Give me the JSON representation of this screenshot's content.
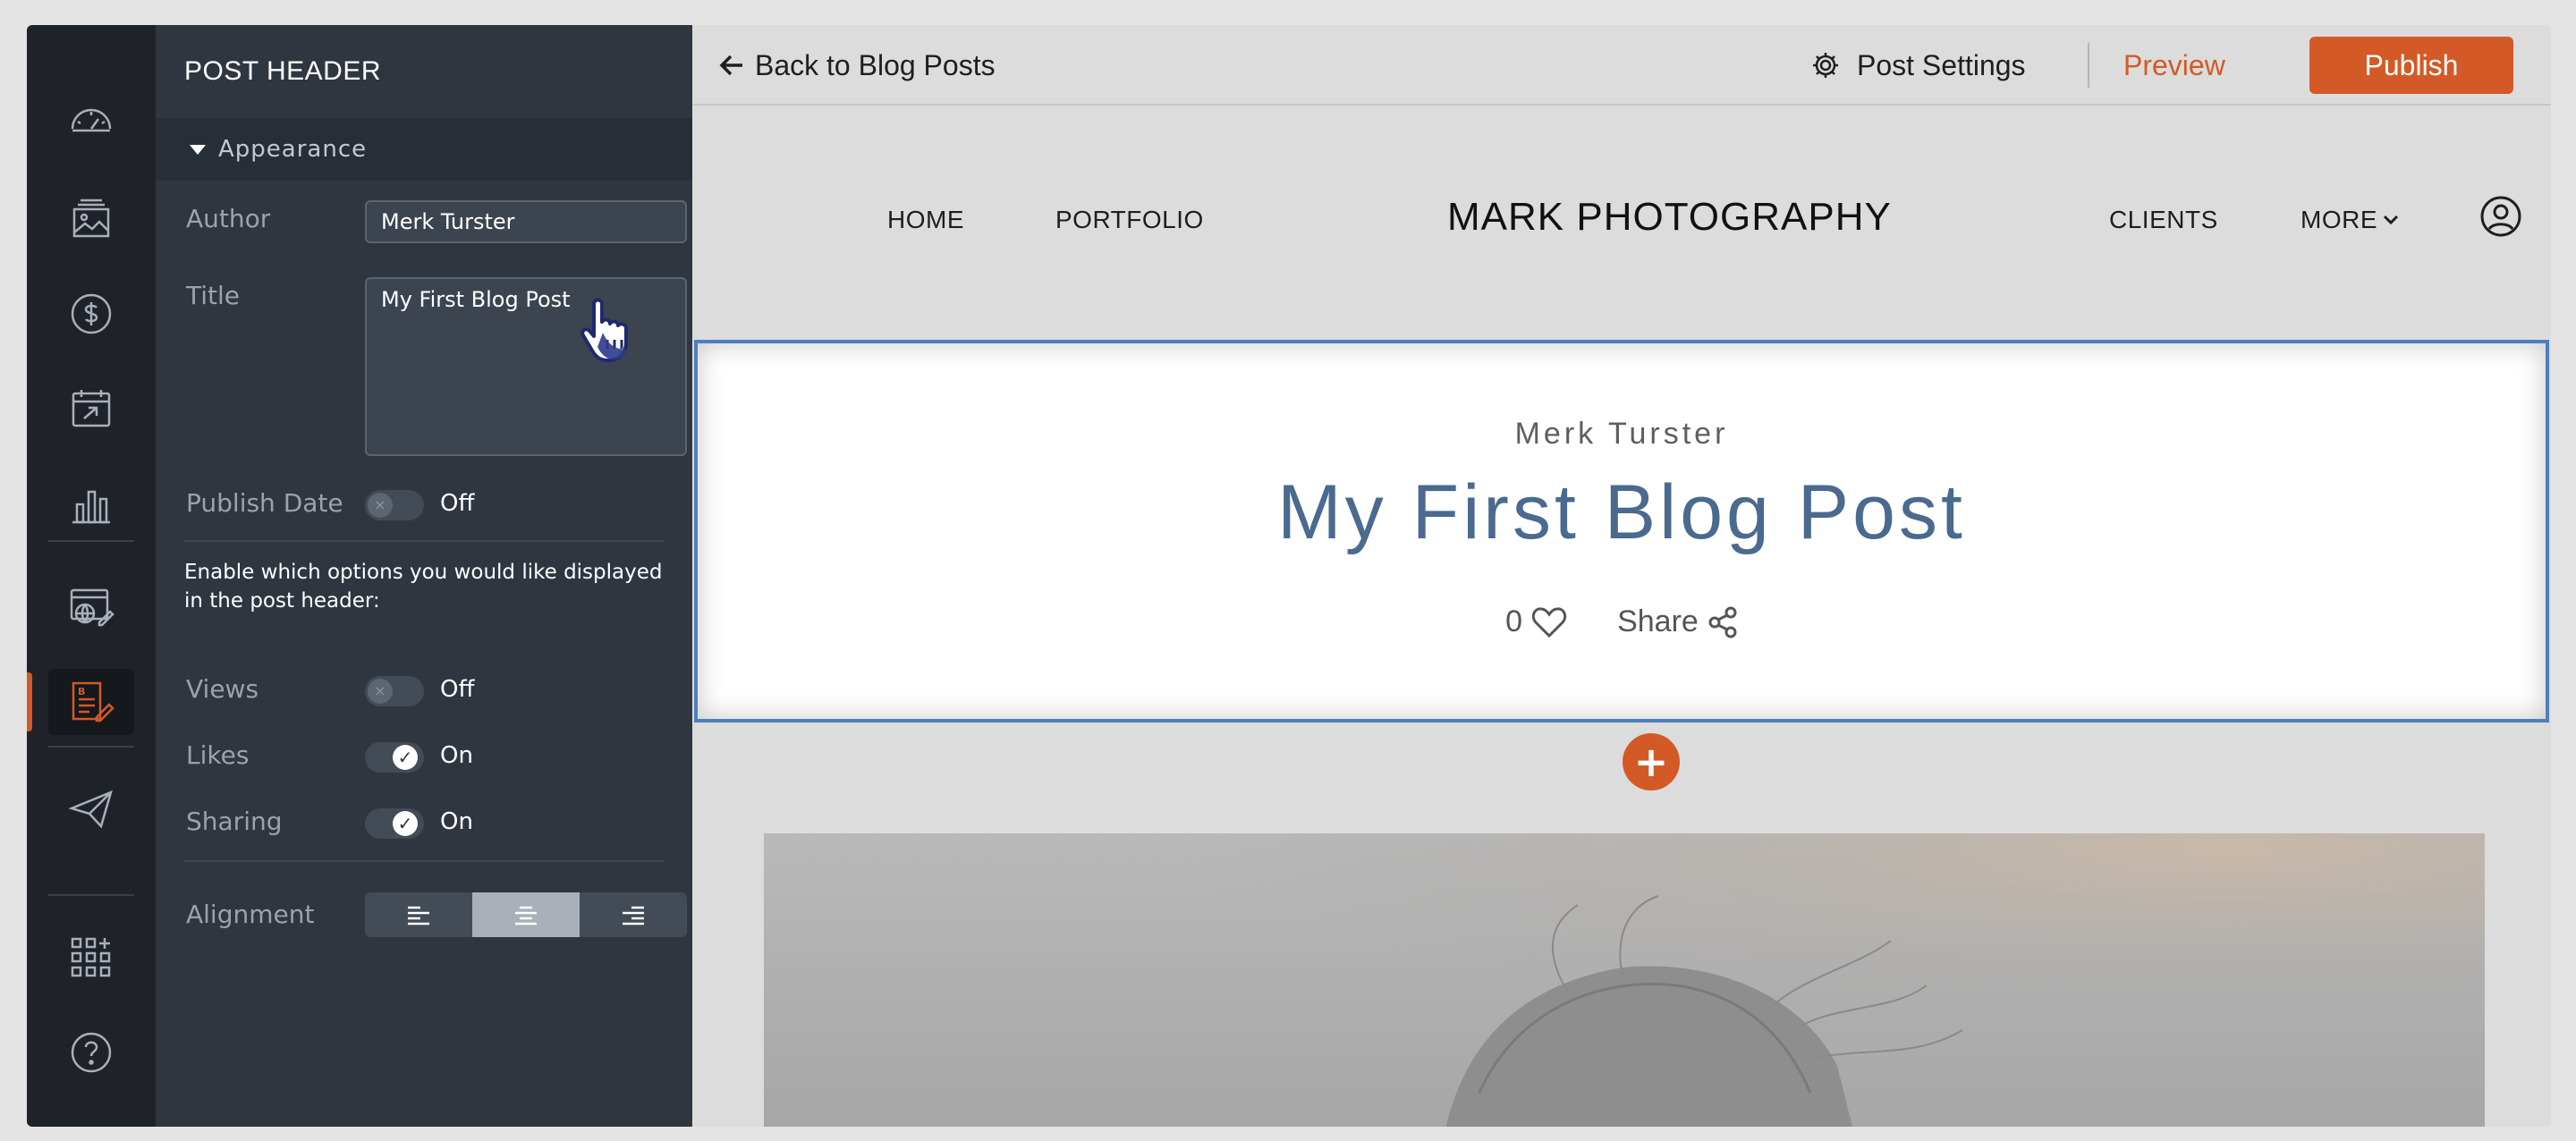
{
  "sidebar": {
    "icons": [
      "dashboard-icon",
      "gallery-icon",
      "dollar-icon",
      "calendar-icon",
      "analytics-icon",
      "website-icon",
      "blog-icon",
      "send-icon",
      "apps-icon",
      "help-icon"
    ],
    "active": "blog-icon"
  },
  "panel": {
    "title": "POST HEADER",
    "section": "Appearance",
    "author_label": "Author",
    "author_value": "Merk Turster",
    "title_label": "Title",
    "title_value": "My First Blog Post",
    "publish_date_label": "Publish Date",
    "publish_date_state": "Off",
    "help_text": "Enable which options you would like displayed in the post header:",
    "views_label": "Views",
    "views_state": "Off",
    "likes_label": "Likes",
    "likes_state": "On",
    "sharing_label": "Sharing",
    "sharing_state": "On",
    "alignment_label": "Alignment",
    "alignment_selected": "center"
  },
  "topbar": {
    "back_label": "Back to Blog Posts",
    "settings_label": "Post Settings",
    "preview_label": "Preview",
    "publish_label": "Publish"
  },
  "site": {
    "nav_left": [
      "HOME",
      "PORTFOLIO"
    ],
    "brand": "MARK PHOTOGRAPHY",
    "nav_right": [
      "CLIENTS",
      "MORE"
    ]
  },
  "post": {
    "author": "Merk Turster",
    "title": "My First Blog Post",
    "likes_count": "0",
    "share_label": "Share"
  },
  "colors": {
    "accent": "#d35a26",
    "selection": "#4d7fbd",
    "title": "#4a6a8f"
  }
}
